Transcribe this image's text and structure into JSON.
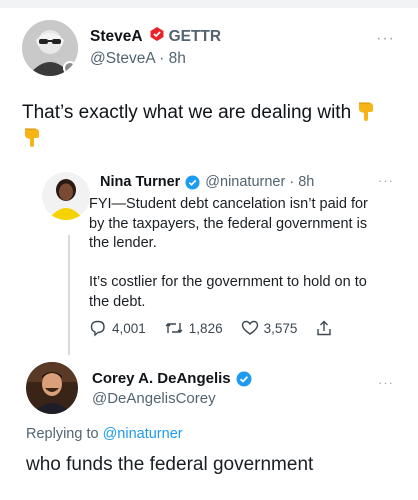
{
  "post": {
    "author_name": "SteveA",
    "platform_label": "GETTR",
    "handle_time": "@SteveA · 8h",
    "text": "That’s exactly what we are dealing with"
  },
  "quoted_tweet": {
    "author_name": "Nina Turner",
    "handle_time": "@ninaturner · 8h",
    "lines": [
      "FYI—Student debt cancelation isn’t paid for",
      "by the taxpayers, the federal government is",
      "the lender.",
      "It’s costlier for the government to hold on to",
      "the debt."
    ],
    "replies": "4,001",
    "retweets": "1,826",
    "likes": "3,575"
  },
  "reply_tweet": {
    "author_name": "Corey A. DeAngelis",
    "handle": "@DeAngelisCorey",
    "replying_prefix": "Replying to",
    "replying_handle": "@ninaturner",
    "text": "who funds the federal government"
  },
  "icons": {
    "more": "more-options-icon",
    "verified": "verified-badge-icon",
    "gettr": "gettr-logo-icon",
    "emoji": "backhand-index-pointing-down"
  },
  "colors": {
    "gettr_red": "#e8242a",
    "twitter_blue": "#1d9bf0",
    "emoji_yellow": "#f7b416"
  }
}
